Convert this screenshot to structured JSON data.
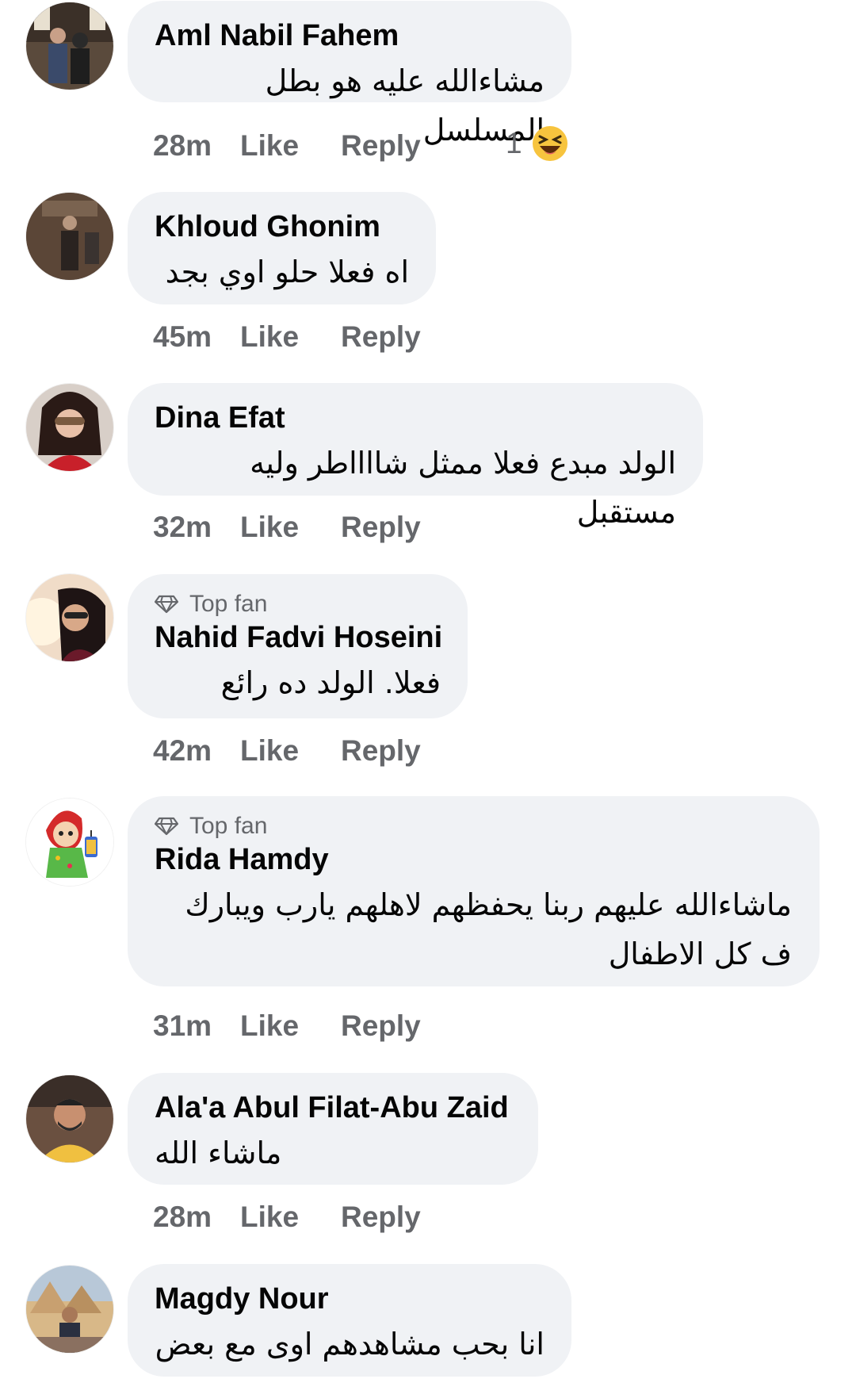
{
  "comments": [
    {
      "author": "Aml Nabil Fahem",
      "text": "مشاءالله عليه هو بطل المسلسل",
      "top_fan": false,
      "time": "28m",
      "like_label": "Like",
      "reply_label": "Reply",
      "reaction_count": "1",
      "reaction_icon": "laughing-emoji-icon"
    },
    {
      "author": "Khloud Ghonim",
      "text": "اه فعلا حلو اوي بجد",
      "top_fan": false,
      "time": "45m",
      "like_label": "Like",
      "reply_label": "Reply"
    },
    {
      "author": "Dina Efat",
      "text": "الولد مبدع فعلا ممثل شااااطر وليه مستقبل",
      "top_fan": false,
      "time": "32m",
      "like_label": "Like",
      "reply_label": "Reply"
    },
    {
      "author": "Nahid Fadvi Hoseini",
      "text": "فعلا.  الولد ده رائع",
      "top_fan": true,
      "top_fan_label": "Top fan",
      "time": "42m",
      "like_label": "Like",
      "reply_label": "Reply"
    },
    {
      "author": "Rida Hamdy",
      "text": "ماشاءالله عليهم ربنا يحفظهم لاهلهم يارب ويبارك ف كل الاطفال",
      "top_fan": true,
      "top_fan_label": "Top fan",
      "time": "31m",
      "like_label": "Like",
      "reply_label": "Reply"
    },
    {
      "author": "Ala'a Abul Filat-Abu Zaid",
      "text": "ماشاء الله",
      "top_fan": false,
      "time": "28m",
      "like_label": "Like",
      "reply_label": "Reply"
    },
    {
      "author": "Magdy Nour",
      "text": "انا بحب مشاهدهم اوى مع بعض",
      "top_fan": false
    }
  ],
  "colors": {
    "bubble_bg": "#f0f2f5",
    "meta_text": "#65676b",
    "primary_text": "#050505"
  }
}
